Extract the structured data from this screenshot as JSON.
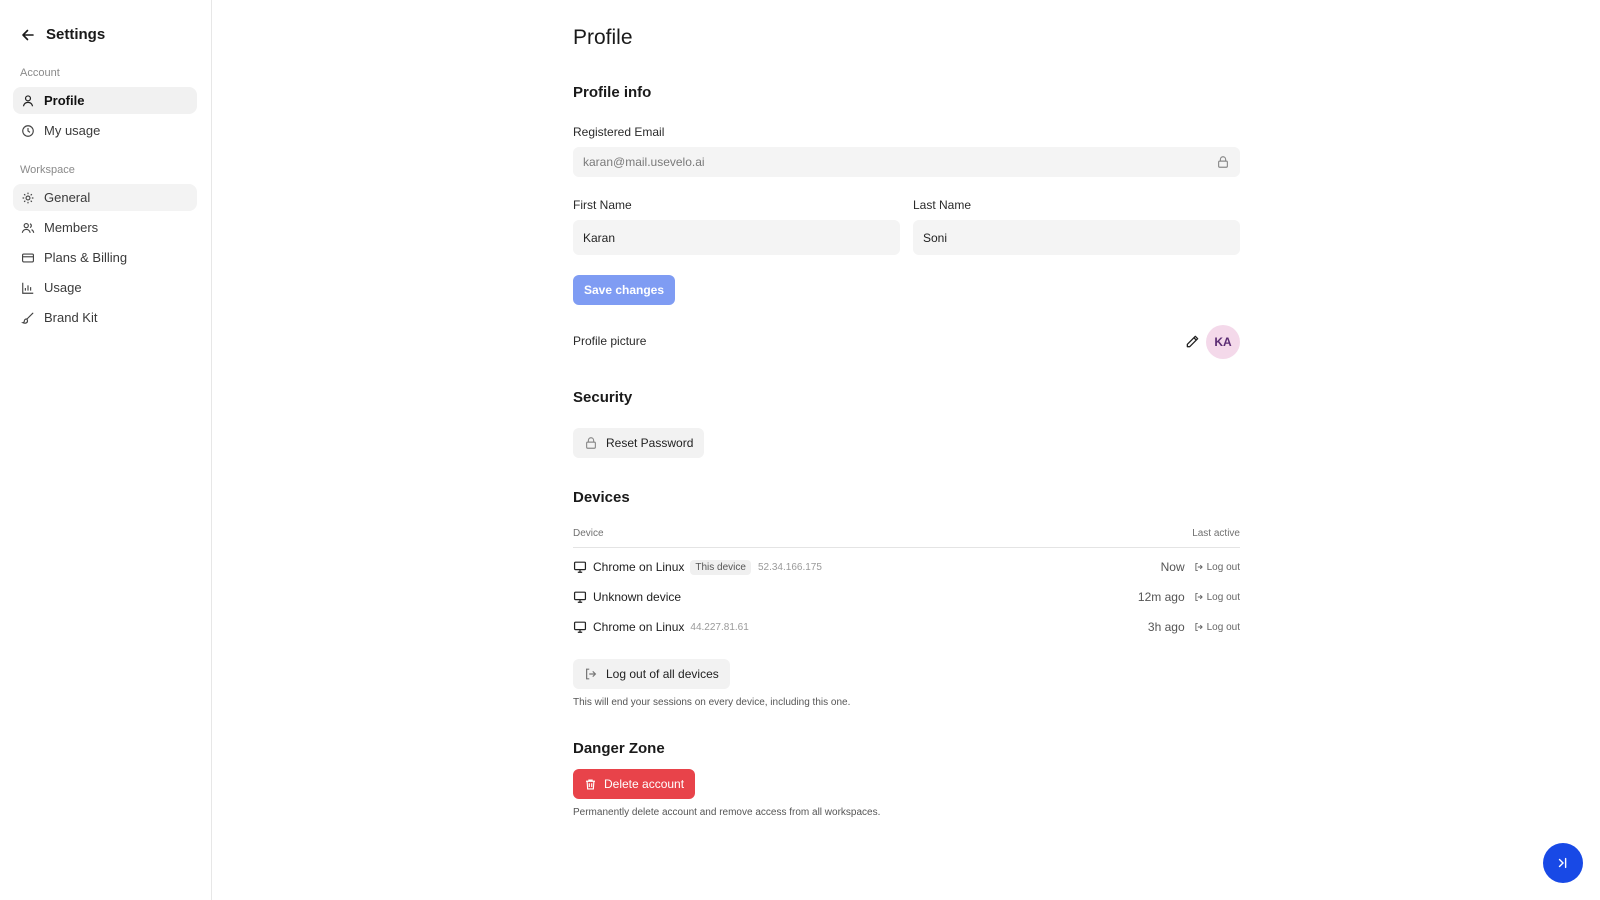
{
  "sidebar": {
    "title": "Settings",
    "back_icon": "arrow-left-icon",
    "sections": [
      {
        "label": "Account"
      },
      {
        "label": "Workspace"
      }
    ],
    "items": [
      {
        "label": "Profile",
        "icon": "user-icon"
      },
      {
        "label": "My usage",
        "icon": "clock-icon"
      },
      {
        "label": "General",
        "icon": "gear-icon"
      },
      {
        "label": "Members",
        "icon": "users-icon"
      },
      {
        "label": "Plans & Billing",
        "icon": "credit-card-icon"
      },
      {
        "label": "Usage",
        "icon": "bar-chart-icon"
      },
      {
        "label": "Brand Kit",
        "icon": "brush-icon"
      }
    ]
  },
  "page": {
    "title": "Profile",
    "profile_info": {
      "heading": "Profile info",
      "email_label": "Registered Email",
      "email_value": "karan@mail.usevelo.ai",
      "first_name_label": "First Name",
      "first_name_value": "Karan",
      "last_name_label": "Last Name",
      "last_name_value": "Soni",
      "save_label": "Save changes",
      "picture_label": "Profile picture",
      "avatar_initials": "KA"
    },
    "security": {
      "heading": "Security",
      "reset_label": "Reset Password"
    },
    "devices": {
      "heading": "Devices",
      "col_device": "Device",
      "col_last_active": "Last active",
      "rows": [
        {
          "name": "Chrome on Linux",
          "badge": "This device",
          "ip": "52.34.166.175",
          "last_active": "Now",
          "action": "Log out"
        },
        {
          "name": "Unknown device",
          "badge": "",
          "ip": "",
          "last_active": "12m ago",
          "action": "Log out"
        },
        {
          "name": "Chrome on Linux",
          "badge": "",
          "ip": "44.227.81.61",
          "last_active": "3h ago",
          "action": "Log out"
        }
      ],
      "logout_all_label": "Log out of all devices",
      "logout_all_help": "This will end your sessions on every device, including this one."
    },
    "danger": {
      "heading": "Danger Zone",
      "delete_label": "Delete account",
      "delete_help": "Permanently delete account and remove access from all workspaces."
    }
  },
  "colors": {
    "primary_button": "#7f9cf3",
    "danger": "#e8434a",
    "fab": "#1849e6",
    "avatar_bg": "#f4d9ea"
  }
}
